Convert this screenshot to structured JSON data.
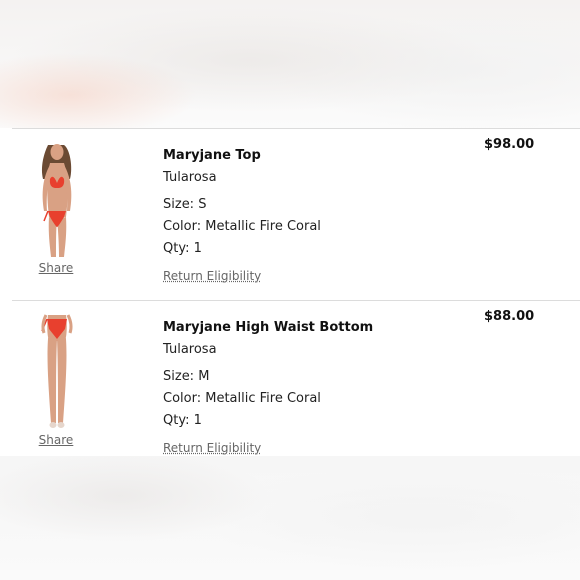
{
  "items": [
    {
      "name": "Maryjane Top",
      "brand": "Tularosa",
      "size": "Size: S",
      "color": "Color: Metallic Fire Coral",
      "qty": "Qty: 1",
      "price": "$98.00",
      "share_label": "Share",
      "return_label": "Return Eligibility"
    },
    {
      "name": "Maryjane High Waist Bottom",
      "brand": "Tularosa",
      "size": "Size: M",
      "color": "Color: Metallic Fire Coral",
      "qty": "Qty: 1",
      "price": "$88.00",
      "share_label": "Share",
      "return_label": "Return Eligibility"
    }
  ],
  "colors": {
    "product": "#e8402e",
    "skin": "#d9a184",
    "hair": "#6b4a33",
    "divider": "#dcdcdc"
  }
}
